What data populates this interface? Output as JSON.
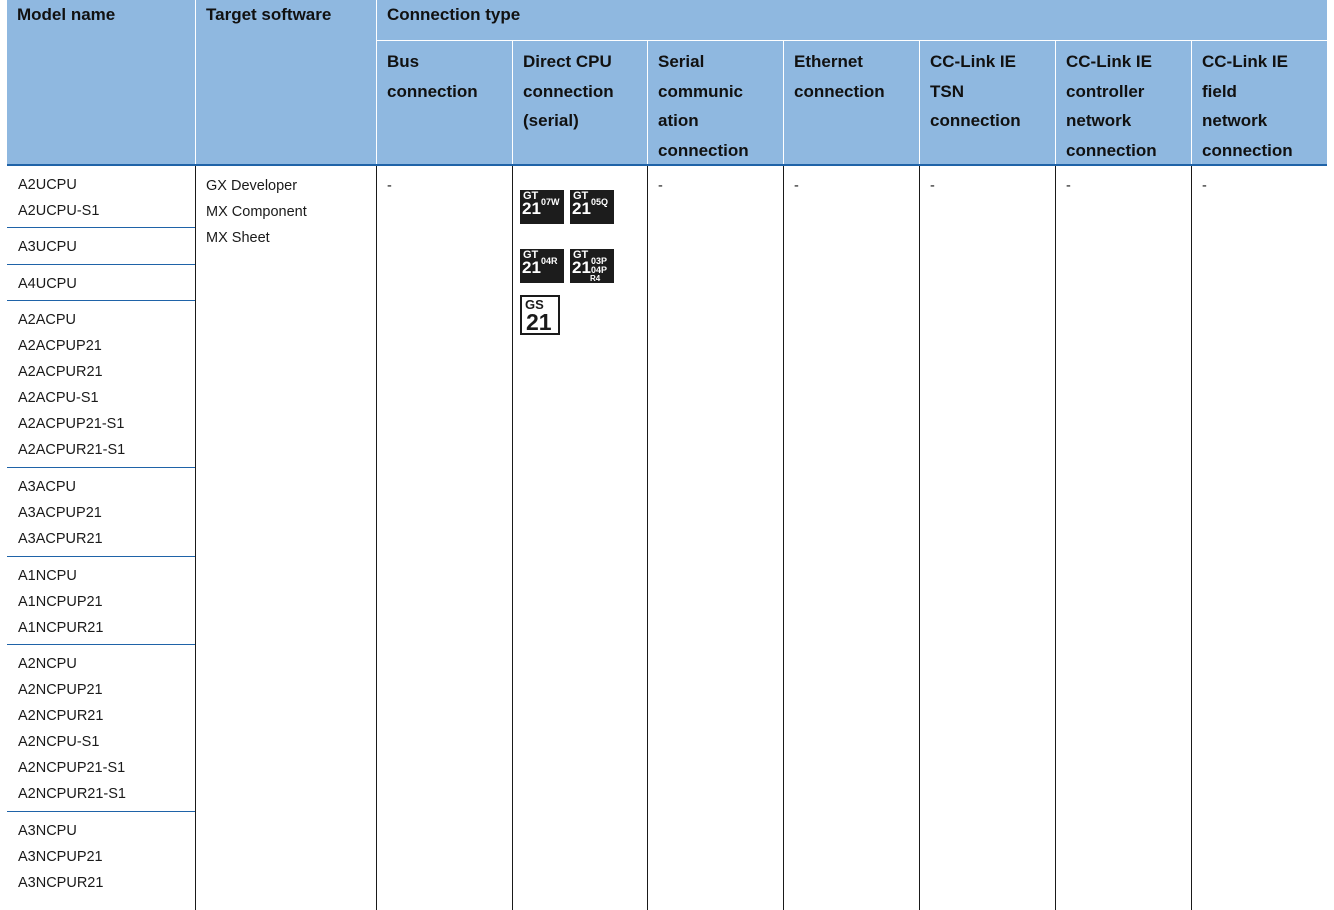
{
  "header": {
    "model_name": "Model name",
    "target_software": "Target software",
    "connection_type": "Connection type",
    "columns": [
      [
        "Bus",
        "connection"
      ],
      [
        "Direct CPU",
        "connection",
        "(serial)"
      ],
      [
        "Serial",
        "communic",
        "ation",
        "connection"
      ],
      [
        "Ethernet",
        "connection"
      ],
      [
        "CC-Link IE",
        "TSN",
        "connection"
      ],
      [
        "CC-Link IE",
        "controller",
        "network",
        "connection"
      ],
      [
        "CC-Link IE",
        "field",
        "network",
        "connection"
      ]
    ]
  },
  "models": [
    [
      "A2UCPU",
      "A2UCPU-S1"
    ],
    [
      "A3UCPU"
    ],
    [
      "A4UCPU"
    ],
    [
      "A2ACPU",
      "A2ACPUP21",
      "A2ACPUR21",
      "A2ACPU-S1",
      "A2ACPUP21-S1",
      "A2ACPUR21-S1"
    ],
    [
      "A3ACPU",
      "A3ACPUP21",
      "A3ACPUR21"
    ],
    [
      "A1NCPU",
      "A1NCPUP21",
      "A1NCPUR21"
    ],
    [
      "A2NCPU",
      "A2NCPUP21",
      "A2NCPUR21",
      "A2NCPU-S1",
      "A2NCPUP21-S1",
      "A2NCPUR21-S1"
    ],
    [
      "A3NCPU",
      "A3NCPUP21",
      "A3NCPUR21"
    ]
  ],
  "software": [
    "GX Developer",
    "MX Component",
    "MX Sheet"
  ],
  "dash": "-",
  "badges": {
    "b1": {
      "gt": "GT",
      "num": "21",
      "s1": "07W"
    },
    "b2": {
      "gt": "GT",
      "num": "21",
      "s1": "05Q"
    },
    "b3": {
      "gt": "GT",
      "num": "21",
      "s1": "04R"
    },
    "b4": {
      "gt": "GT",
      "num": "21",
      "s1": "03P",
      "s2": "04P",
      "s3": "R4"
    },
    "gs": {
      "gt": "GS",
      "num": "21"
    }
  }
}
